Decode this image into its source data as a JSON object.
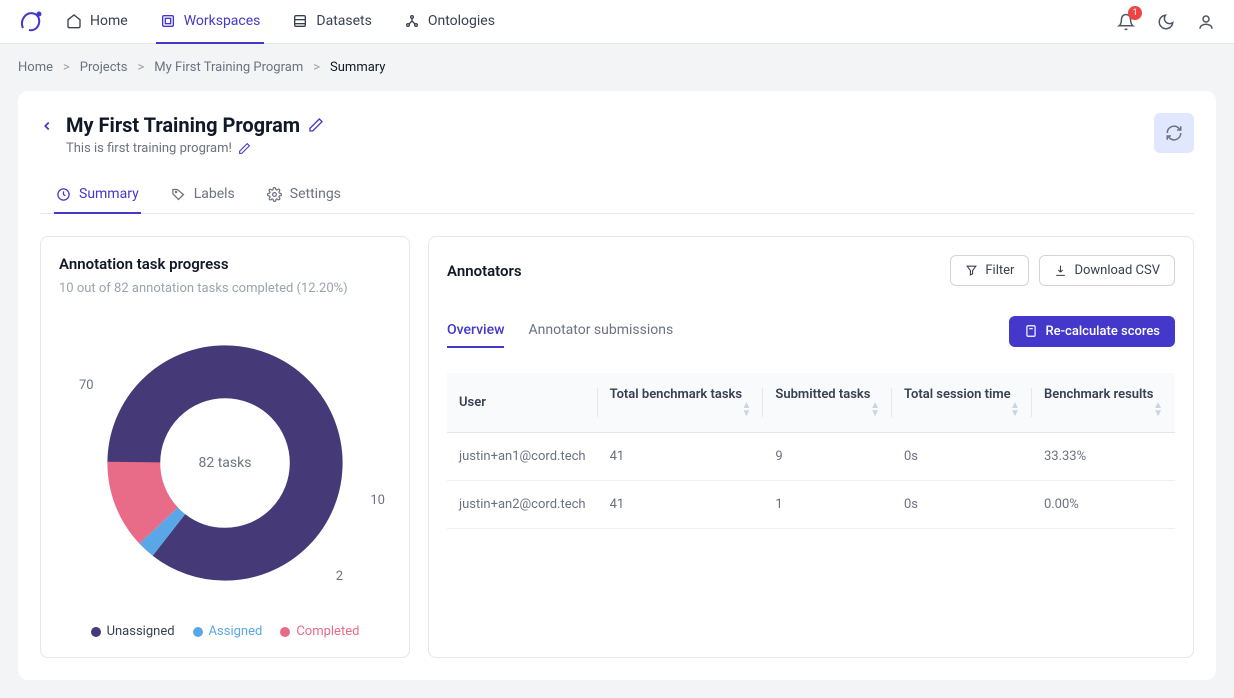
{
  "nav": {
    "items": [
      {
        "label": "Home",
        "active": false
      },
      {
        "label": "Workspaces",
        "active": true
      },
      {
        "label": "Datasets",
        "active": false
      },
      {
        "label": "Ontologies",
        "active": false
      }
    ],
    "notification_count": "1"
  },
  "breadcrumb": {
    "parts": [
      "Home",
      "Projects",
      "My First Training Program"
    ],
    "current": "Summary"
  },
  "page": {
    "title": "My First Training Program",
    "subtitle": "This is first training program!"
  },
  "tabs": [
    {
      "label": "Summary",
      "active": true
    },
    {
      "label": "Labels",
      "active": false
    },
    {
      "label": "Settings",
      "active": false
    }
  ],
  "progress": {
    "title": "Annotation task progress",
    "subtitle": "10 out of 82 annotation tasks completed (12.20%)",
    "center_label": "82 tasks",
    "labels": {
      "unassigned": "70",
      "assigned": "2",
      "completed": "10"
    },
    "legend": [
      {
        "label": "Unassigned",
        "color": "#453a77"
      },
      {
        "label": "Assigned",
        "color": "#5aa7e8"
      },
      {
        "label": "Completed",
        "color": "#e86b87"
      }
    ]
  },
  "annotators": {
    "title": "Annotators",
    "filter_label": "Filter",
    "download_label": "Download CSV",
    "sub_tabs": [
      {
        "label": "Overview",
        "active": true
      },
      {
        "label": "Annotator submissions",
        "active": false
      }
    ],
    "recalc_label": "Re-calculate scores",
    "columns": [
      "User",
      "Total benchmark tasks",
      "Submitted tasks",
      "Total session time",
      "Benchmark results"
    ],
    "rows": [
      {
        "user": "justin+an1@cord.tech",
        "total_benchmark": "41",
        "submitted": "9",
        "session": "0s",
        "result": "33.33%"
      },
      {
        "user": "justin+an2@cord.tech",
        "total_benchmark": "41",
        "submitted": "1",
        "session": "0s",
        "result": "0.00%"
      }
    ]
  },
  "chart_data": {
    "type": "pie",
    "title": "Annotation task progress",
    "total": 82,
    "series": [
      {
        "name": "Unassigned",
        "value": 70,
        "color": "#453a77"
      },
      {
        "name": "Assigned",
        "value": 2,
        "color": "#5aa7e8"
      },
      {
        "name": "Completed",
        "value": 10,
        "color": "#e86b87"
      }
    ]
  }
}
